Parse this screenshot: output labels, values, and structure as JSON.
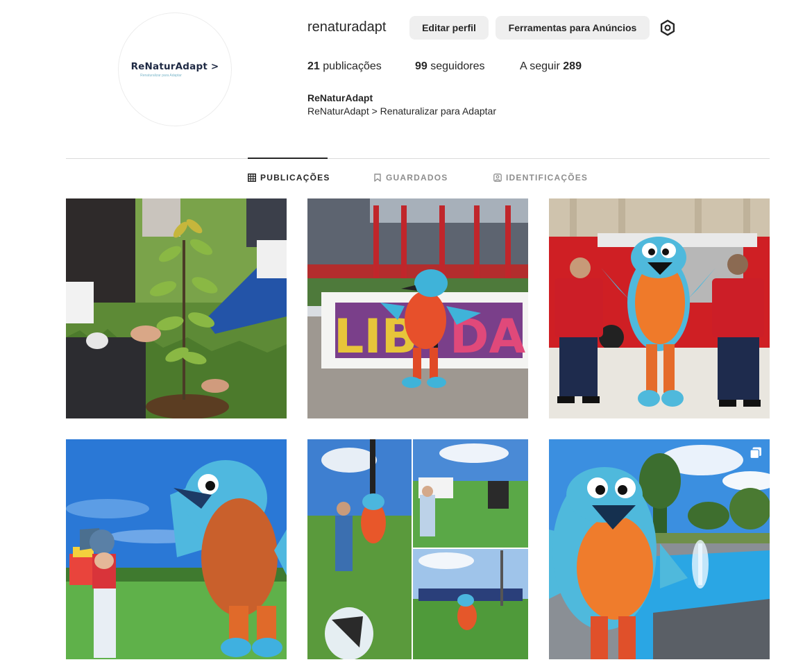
{
  "profile": {
    "username": "renaturadapt",
    "avatar_brand": "ReNaturAdapt >",
    "avatar_tagline": "Renaturalizar para Adaptar",
    "edit_button": "Editar perfil",
    "ads_button": "Ferramentas para Anúncios",
    "settings_icon": "gear-icon",
    "stats": {
      "posts_count": "21",
      "posts_label": "publicações",
      "followers_count": "99",
      "followers_label": "seguidores",
      "following_label": "A seguir",
      "following_count": "289"
    },
    "bio_name": "ReNaturAdapt",
    "bio_text": "ReNaturAdapt > Renaturalizar para Adaptar"
  },
  "tabs": [
    {
      "label": "PUBLICAÇÕES",
      "icon": "grid-icon",
      "active": true
    },
    {
      "label": "GUARDADOS",
      "icon": "bookmark-icon",
      "active": false
    },
    {
      "label": "IDENTIFICAÇÕES",
      "icon": "tag-user-icon",
      "active": false
    }
  ],
  "posts": [
    {
      "subject": "planting-shrub"
    },
    {
      "subject": "mascot-graffiti-wall"
    },
    {
      "subject": "mascot-firefighters"
    },
    {
      "subject": "mascot-child-park"
    },
    {
      "subject": "mascot-collage"
    },
    {
      "subject": "mascot-fountain",
      "multi_icon": "carousel-icon"
    }
  ],
  "colors": {
    "text": "#262626",
    "muted": "#8e8e8e",
    "button_bg": "#efefef",
    "divider": "#dbdbdb"
  }
}
